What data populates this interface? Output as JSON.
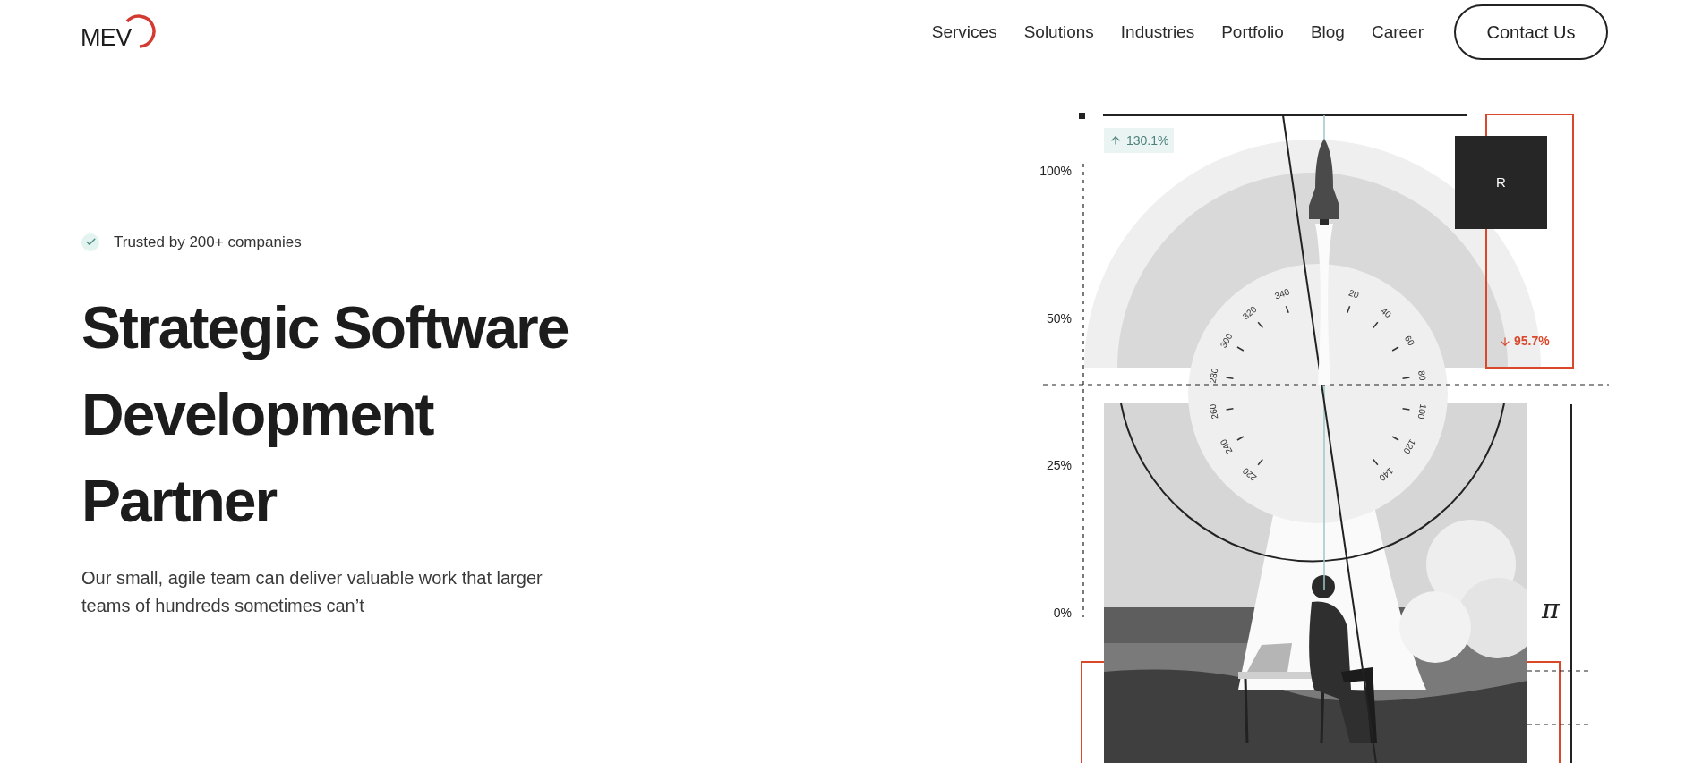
{
  "logo": {
    "text": "MEV"
  },
  "nav": {
    "items": [
      {
        "label": "Services"
      },
      {
        "label": "Solutions"
      },
      {
        "label": "Industries"
      },
      {
        "label": "Portfolio"
      },
      {
        "label": "Blog"
      },
      {
        "label": "Career"
      }
    ],
    "cta": "Contact Us"
  },
  "hero": {
    "badge": "Trusted by 200+ companies",
    "title_lines": [
      "Strategic Software",
      "Development",
      "Partner"
    ],
    "subtitle": "Our small, agile team can deliver valuable work that larger teams of hundreds sometimes can’t"
  },
  "graphic": {
    "axis_labels": [
      "100%",
      "50%",
      "25%",
      "0%"
    ],
    "growth": {
      "text": "130.1%",
      "kind": "up"
    },
    "decline": {
      "text": "95.7%",
      "kind": "down"
    },
    "box_letter": "R",
    "dial_labels": [
      "20",
      "40",
      "60",
      "80",
      "100",
      "120",
      "140",
      "220",
      "240",
      "260",
      "280",
      "300",
      "320",
      "340"
    ],
    "symbol": "π"
  }
}
